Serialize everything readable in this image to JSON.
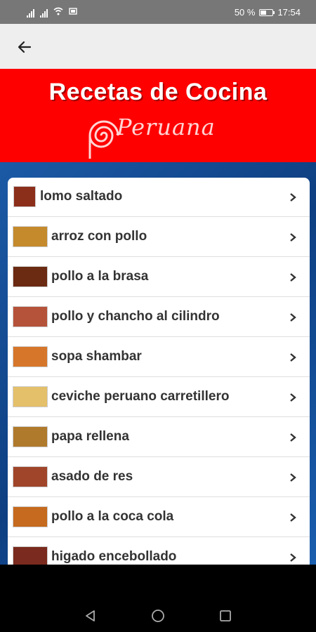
{
  "status_bar": {
    "battery_percent": "50 %",
    "time": "17:54"
  },
  "toolbar": {
    "back_icon": "arrow-left-icon"
  },
  "banner": {
    "title": "Recetas de Cocina",
    "logo_text": "Peruana",
    "background_color": "#ff0000"
  },
  "recipes": [
    {
      "label": "lomo saltado",
      "thumb_color": "#8b2e1a"
    },
    {
      "label": "arroz con pollo",
      "thumb_color": "#c48a2c"
    },
    {
      "label": "pollo a la brasa",
      "thumb_color": "#6b2a12"
    },
    {
      "label": "pollo y chancho al cilindro",
      "thumb_color": "#b5523a"
    },
    {
      "label": "sopa shambar",
      "thumb_color": "#d6762a"
    },
    {
      "label": "ceviche peruano carretillero",
      "thumb_color": "#e5c06a"
    },
    {
      "label": "papa rellena",
      "thumb_color": "#b07a2c"
    },
    {
      "label": "asado de res",
      "thumb_color": "#a0452a"
    },
    {
      "label": "pollo a la coca cola",
      "thumb_color": "#c56a1e"
    },
    {
      "label": "higado encebollado",
      "thumb_color": "#7a2a1e"
    }
  ],
  "nav": {
    "back_icon": "triangle-back-icon",
    "home_icon": "circle-home-icon",
    "recents_icon": "square-recents-icon"
  }
}
